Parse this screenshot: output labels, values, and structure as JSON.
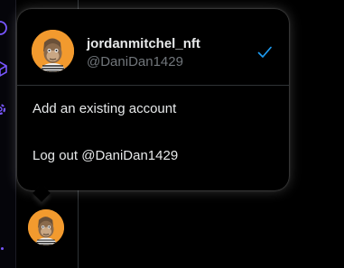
{
  "account_switcher": {
    "current_account": {
      "display_name": "jordanmitchel_nft",
      "handle": "@DaniDan1429",
      "avatar_icon": "ape-avatar-icon",
      "selected_icon": "checkmark-icon"
    },
    "menu": {
      "add_existing": "Add an existing account",
      "logout": "Log out @DaniDan1429"
    }
  },
  "sidebar": {
    "account_button_avatar": "ape-avatar-icon"
  },
  "colors": {
    "accent": "#1d9bf0",
    "avatar_bg": "#f29a2e",
    "rail_icon": "#7856ff",
    "handle_text": "#71767b"
  }
}
